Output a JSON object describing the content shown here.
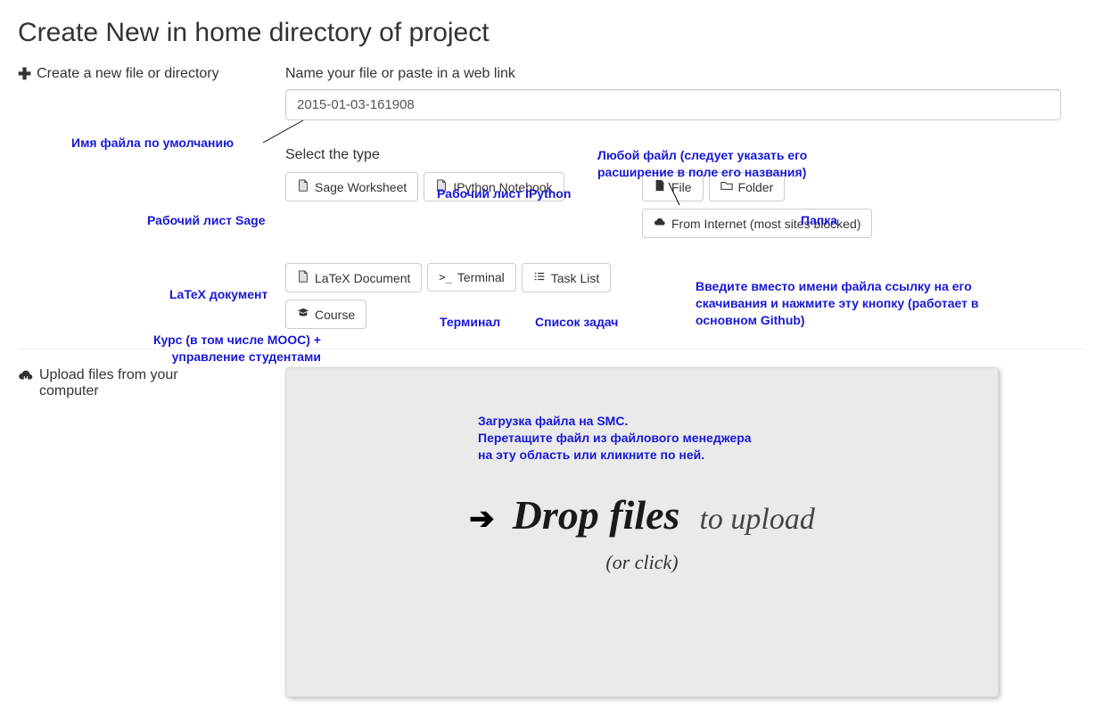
{
  "title": "Create New in home directory of project",
  "section_create": "Create a new file or directory",
  "name_label": "Name your file or paste in a web link",
  "filename_value": "2015-01-03-161908",
  "select_type_label": "Select the type",
  "buttons": {
    "sage": "Sage Worksheet",
    "ipython": "IPython Notebook",
    "file": "File",
    "folder": "Folder",
    "internet": "From Internet (most sites blocked)",
    "latex": "LaTeX Document",
    "terminal": "Terminal",
    "tasklist": "Task List",
    "course": "Course"
  },
  "upload_section": "Upload files from your computer",
  "dropzone": {
    "main": "Drop files",
    "sub": "to upload",
    "or": "(or click)"
  },
  "annotations": {
    "default_name": "Имя файла по умолчанию",
    "sage_ws": "Рабочий лист Sage",
    "ipython_ws": "Рабочий лист IPython",
    "any_file": "Любой файл (следует указать его расширение в поле его названия)",
    "folder": "Папка",
    "latex_doc": "LaTeX документ",
    "terminal": "Терминал",
    "tasklist": "Список задач",
    "internet": "Введите вместо имени файла ссылку на его скачивания и нажмите эту кнопку (работает в основном Github)",
    "course": "Курс (в том числе MOOC) + управление студентами",
    "upload": "Загрузка файла на SMC.\nПеретащите файл из файлового менеджера\nна эту область или кликните по ней."
  }
}
